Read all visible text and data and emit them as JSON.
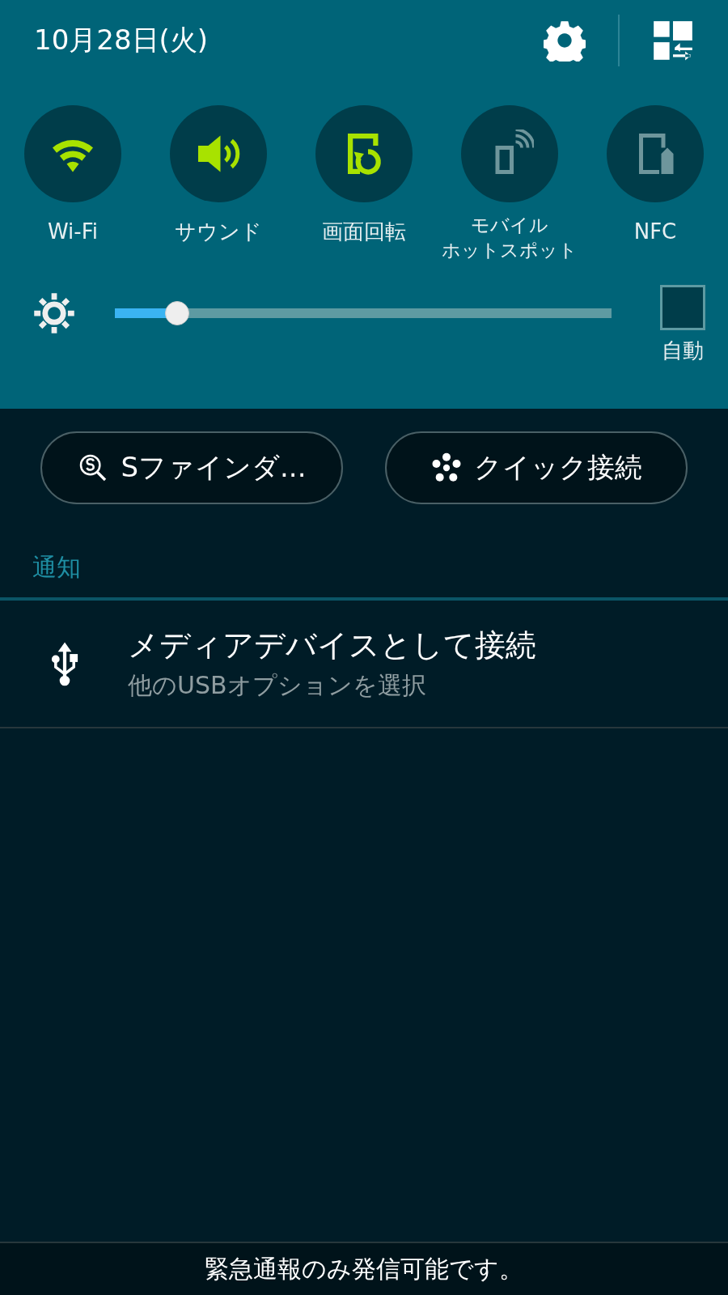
{
  "header": {
    "date": "10月28日(火)"
  },
  "toggles": [
    {
      "kind": "wifi",
      "label": "Wi-Fi",
      "on": true
    },
    {
      "kind": "sound",
      "label": "サウンド",
      "on": true
    },
    {
      "kind": "rotate",
      "label": "画面回転",
      "on": true
    },
    {
      "kind": "hotspot",
      "label": "モバイル",
      "label_2": "ホットスポット",
      "on": false
    },
    {
      "kind": "nfc",
      "label": "NFC",
      "on": false
    }
  ],
  "brightness": {
    "level": 0.125,
    "auto": {
      "label": "自動",
      "checked": false
    }
  },
  "buttons": [
    {
      "kind": "finder",
      "label": "Sファインダ..."
    },
    {
      "kind": "quick",
      "label": "クイック接続"
    }
  ],
  "notifications_header": "通知",
  "notifications": [
    {
      "title": "メディアデバイスとして接続",
      "subtitle": "他のUSBオプションを選択"
    }
  ],
  "footer": "緊急通報のみ発信可能です。"
}
